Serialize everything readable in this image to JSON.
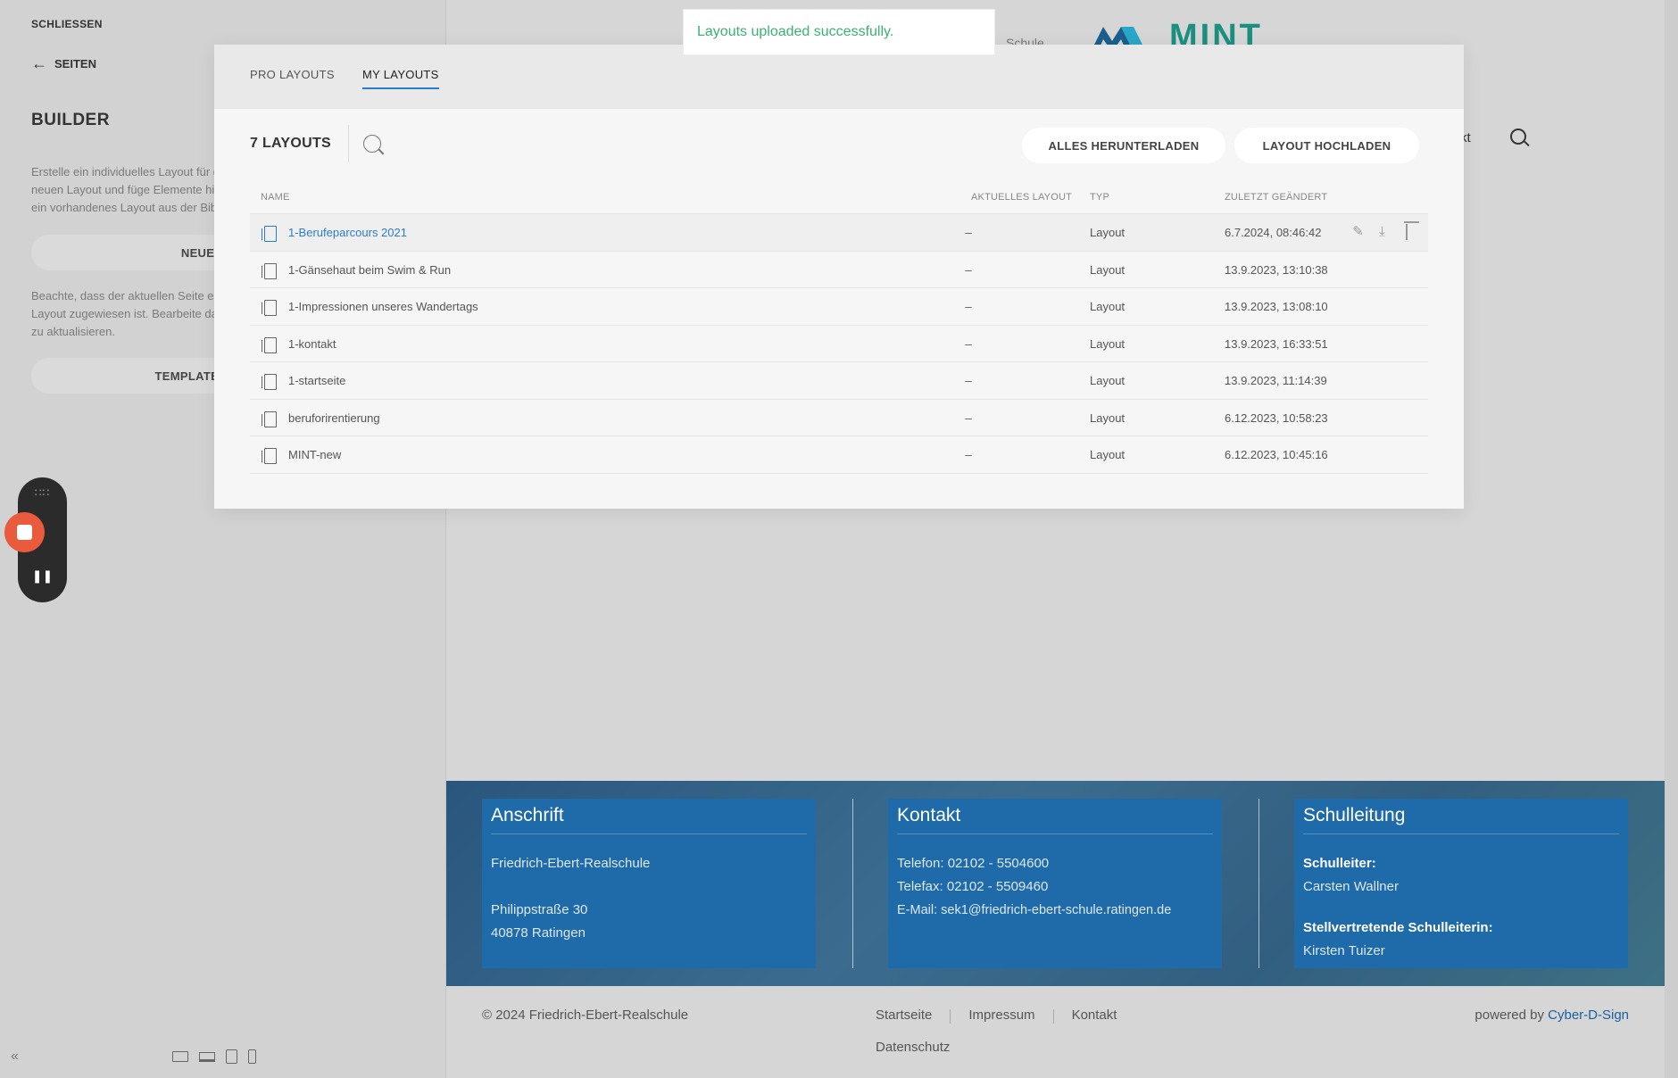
{
  "sidebar": {
    "close_label": "SCHLIESSEN",
    "back_label": "SEITEN",
    "title": "BUILDER",
    "text_1": "Erstelle ein individuelles Layout für die aktuelle Seite. Beginne mit einem neuen Layout und füge Elemente hinzu, oder wähle ein Template oder lade ein vorhandenes Layout aus der Bibliothek.",
    "new_button": "NEUES LAYOUT",
    "text_2": "Beachte, dass der aktuellen Seite ein Template zugeordnet ist und ihr kein Layout zugewiesen ist. Bearbeite das Template, um alle zugehörigen Seiten zu aktualisieren.",
    "template_button": "TEMPLATE BEARBEITEN"
  },
  "preview": {
    "header_partial_text": "Schule",
    "logo_text": "MINT",
    "nav_partial": "kt",
    "footer": {
      "anschrift": {
        "title": "Anschrift",
        "line1": "Friedrich-Ebert-Realschule",
        "line2": "Philippstraße 30",
        "line3": "40878 Ratingen"
      },
      "kontakt": {
        "title": "Kontakt",
        "phone": "Telefon: 02102 - 5504600",
        "fax": "Telefax: 02102 - 5509460",
        "email": "E-Mail: sek1@friedrich-ebert-schule.ratingen.de"
      },
      "schulleitung": {
        "title": "Schulleitung",
        "label1": "Schulleiter:",
        "name1": "Carsten Wallner",
        "label2": "Stellvertretende Schulleiterin:",
        "name2": "Kirsten Tuizer"
      }
    },
    "copyright": "© 2024 Friedrich-Ebert-Realschule",
    "links": [
      "Startseite",
      "Impressum",
      "Kontakt"
    ],
    "datenschutz": "Datenschutz",
    "powered_prefix": "powered by ",
    "powered_link": "Cyber-D-Sign"
  },
  "toast": {
    "message": "Layouts uploaded successfully.",
    "color": "#3bb271"
  },
  "modal": {
    "tabs": [
      "PRO LAYOUTS",
      "MY LAYOUTS"
    ],
    "active_tab": "MY LAYOUTS",
    "count_label": "7 LAYOUTS",
    "download_all": "ALLES HERUNTERLADEN",
    "upload": "LAYOUT HOCHLADEN",
    "columns": [
      "NAME",
      "AKTUELLES LAYOUT",
      "TYP",
      "ZULETZT GEÄNDERT"
    ],
    "rows": [
      {
        "name": "1-Berufeparcours 2021",
        "current": "–",
        "type": "Layout",
        "modified": "6.7.2024, 08:46:42"
      },
      {
        "name": "1-Gänsehaut beim Swim & Run",
        "current": "–",
        "type": "Layout",
        "modified": "13.9.2023, 13:10:38"
      },
      {
        "name": "1-Impressionen unseres Wandertags",
        "current": "–",
        "type": "Layout",
        "modified": "13.9.2023, 13:08:10"
      },
      {
        "name": "1-kontakt",
        "current": "–",
        "type": "Layout",
        "modified": "13.9.2023, 16:33:51"
      },
      {
        "name": "1-startseite",
        "current": "–",
        "type": "Layout",
        "modified": "13.9.2023, 11:14:39"
      },
      {
        "name": "beruforirentierung",
        "current": "–",
        "type": "Layout",
        "modified": "6.12.2023, 10:58:23"
      },
      {
        "name": "MINT-new",
        "current": "–",
        "type": "Layout",
        "modified": "6.12.2023, 10:45:16"
      }
    ],
    "row_action_icons": [
      "pencil-icon",
      "download-icon",
      "trash-icon"
    ],
    "accent_color": "#2a7ccc"
  }
}
